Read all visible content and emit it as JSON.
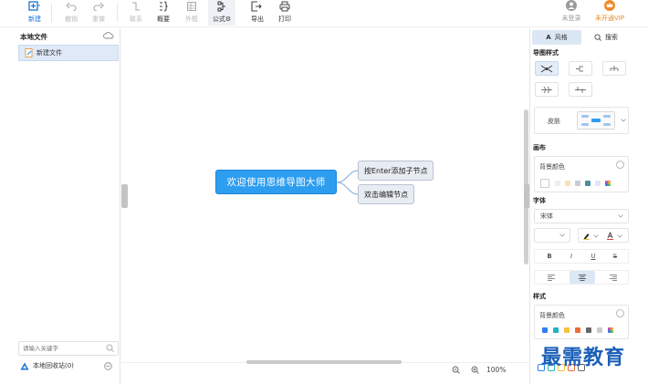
{
  "toolbar": {
    "new": "新建",
    "undo": "撤销",
    "redo": "重做",
    "link": "联系",
    "summary": "概要",
    "frame": "外框",
    "formula": "公式",
    "export": "导出",
    "print": "打印",
    "login": "未登录",
    "vip": "未开通VIP"
  },
  "sidebar": {
    "title": "本地文件",
    "file": "新建文件",
    "search_placeholder": "请输入关键字",
    "recycle": "本地回收站(0)"
  },
  "canvas": {
    "root": "欢迎使用思维导图大师",
    "child1": "按Enter添加子节点",
    "child2": "双击编辑节点",
    "zoom": "100%"
  },
  "panel": {
    "tab_style": "风格",
    "tab_search": "搜索",
    "map_style": "导图样式",
    "skin": "皮肤",
    "canvas_section": "画布",
    "bg_color": "背景颜色",
    "font_section": "字体",
    "font_name": "宋体",
    "bold": "B",
    "italic": "I",
    "underline": "U",
    "strike": "S",
    "style_section": "样式",
    "style_bg_color": "背景颜色"
  },
  "colors": {
    "accent": "#2d9df0",
    "swatches": [
      "#2e7ff0",
      "#1fb5c4",
      "#f4c23d",
      "#f06a3a",
      "#666666",
      "#cccccc"
    ]
  },
  "watermark": "最需教育"
}
